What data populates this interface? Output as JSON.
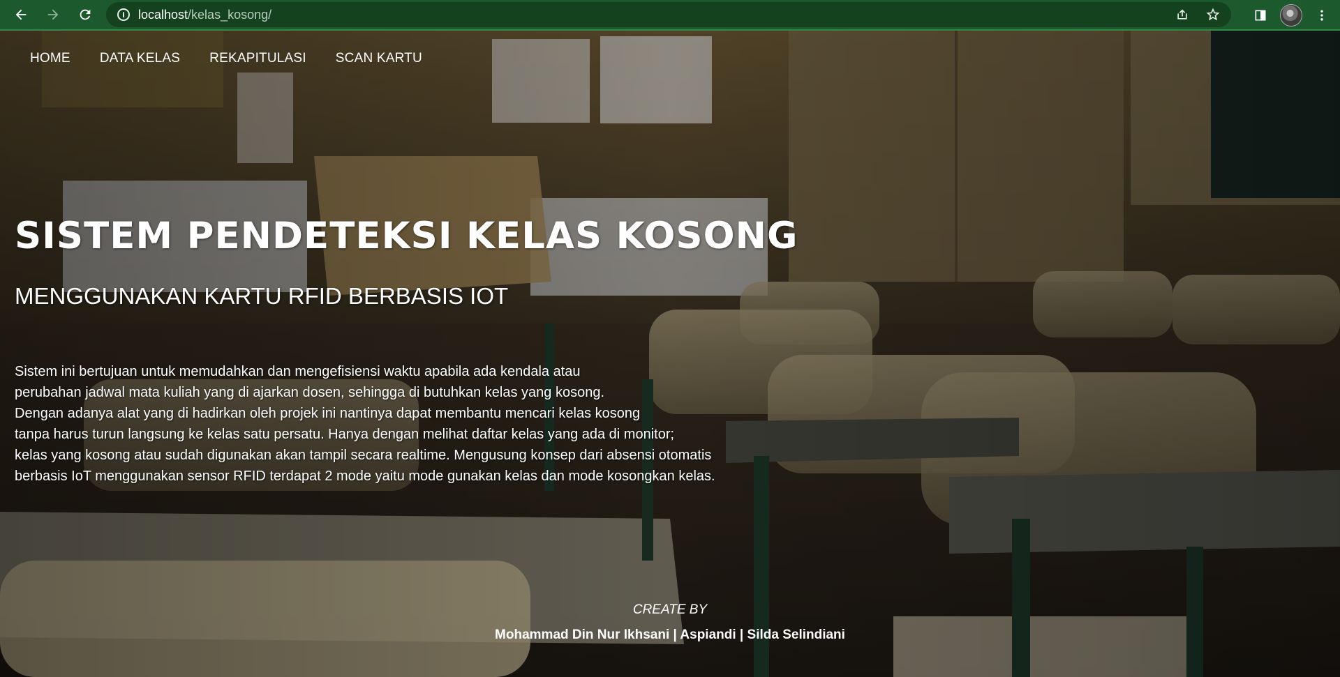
{
  "browser": {
    "url_host": "localhost",
    "url_path": "/kelas_kosong/",
    "icons": [
      "back-icon",
      "forward-icon",
      "reload-icon",
      "info-icon",
      "share-icon",
      "star-icon",
      "sidepanel-icon",
      "avatar",
      "kebab-menu-icon"
    ]
  },
  "navbar": {
    "items": [
      {
        "label": "HOME"
      },
      {
        "label": "DATA KELAS"
      },
      {
        "label": "REKAPITULASI"
      },
      {
        "label": "SCAN KARTU"
      }
    ]
  },
  "hero": {
    "title": "SISTEM PENDETEKSI KELAS KOSONG",
    "subtitle": "MENGGUNAKAN KARTU RFID BERBASIS IOT",
    "description_lines": [
      "Sistem ini bertujuan untuk memudahkan dan mengefisiensi waktu apabila ada kendala atau",
      "perubahan jadwal mata kuliah yang di ajarkan dosen, sehingga di butuhkan kelas yang kosong.",
      "Dengan adanya alat yang di hadirkan oleh projek ini nantinya dapat membantu mencari kelas kosong",
      "tanpa harus turun langsung ke kelas satu persatu. Hanya dengan melihat daftar kelas yang ada di monitor;",
      "kelas yang kosong atau sudah digunakan akan tampil secara realtime. Mengusung konsep dari absensi otomatis",
      "berbasis IoT menggunakan sensor RFID terdapat 2 mode yaitu mode gunakan kelas dan mode kosongkan kelas."
    ]
  },
  "footer": {
    "create_by": "CREATE BY",
    "authors": "Mohammad Din Nur Ikhsani | Aspiandi | Silda Selindiani"
  },
  "colors": {
    "browser_bar": "#1c5a2e",
    "omnibox": "#14421f",
    "text": "#ffffff"
  }
}
